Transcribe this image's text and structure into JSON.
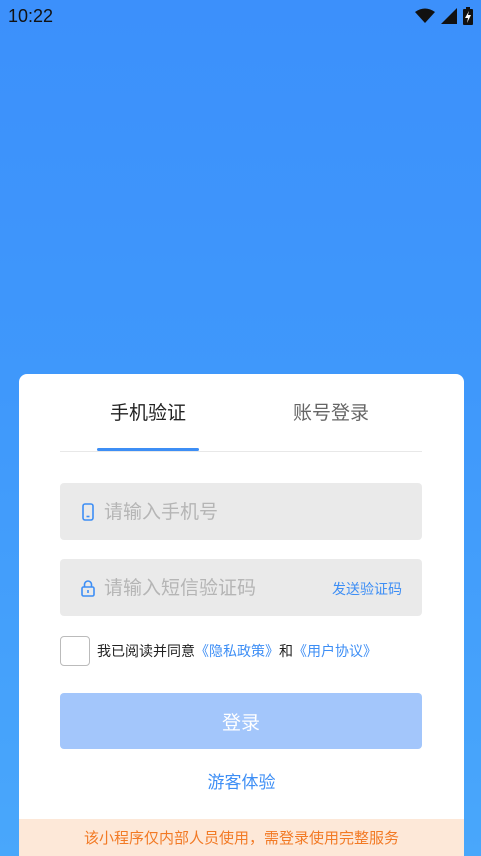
{
  "status_bar": {
    "time": "10:22",
    "icons": [
      "wifi-icon",
      "signal-icon",
      "battery-charging-icon"
    ]
  },
  "tabs": [
    {
      "label": "手机验证",
      "active": true
    },
    {
      "label": "账号登录",
      "active": false
    }
  ],
  "phone_field": {
    "placeholder": "请输入手机号",
    "value": "",
    "icon": "phone-icon"
  },
  "code_field": {
    "placeholder": "请输入短信验证码",
    "value": "",
    "icon": "lock-icon",
    "send_label": "发送验证码"
  },
  "agreement": {
    "checked": false,
    "prefix": "我已阅读并同意",
    "privacy_link": "《隐私政策》",
    "conjunction": "和",
    "terms_link": "《用户协议》"
  },
  "login_button": {
    "label": "登录"
  },
  "guest_link": {
    "label": "游客体验"
  },
  "notice": {
    "text": "该小程序仅内部人员使用，需登录使用完整服务"
  },
  "colors": {
    "gradient_top": "#3c90fb",
    "gradient_bottom": "#49a7fb",
    "accent": "#3d8ef5",
    "button_disabled": "#a3c6fb",
    "notice_bg": "#fde8d8",
    "notice_text": "#f27a25"
  }
}
